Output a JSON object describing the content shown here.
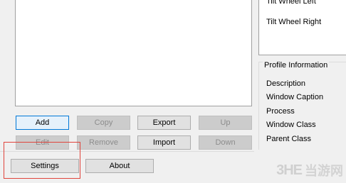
{
  "buttons": {
    "add": "Add",
    "copy": "Copy",
    "export": "Export",
    "up": "Up",
    "edit": "Edit",
    "remove": "Remove",
    "import": "Import",
    "down": "Down",
    "settings": "Settings",
    "about": "About"
  },
  "action_list": {
    "items": [
      "Tilt Wheel Left",
      "Tilt Wheel Right"
    ]
  },
  "profile_info": {
    "title": "Profile Information",
    "items": [
      "Description",
      "Window Caption",
      "Process",
      "Window Class",
      "Parent Class"
    ]
  },
  "watermark": {
    "logo": "3HE",
    "text": "当游网"
  },
  "colors": {
    "highlight": "#e0443c",
    "focus_border": "#0078d7"
  }
}
